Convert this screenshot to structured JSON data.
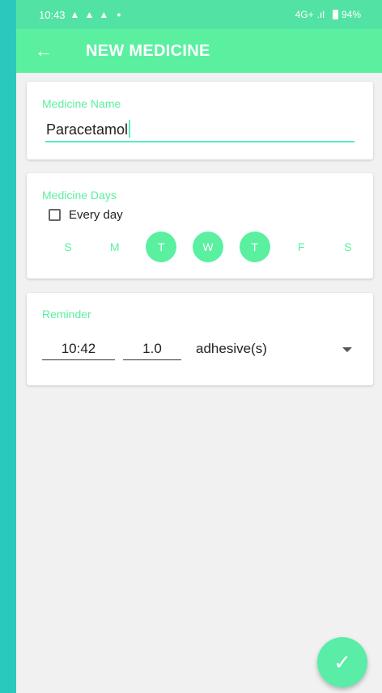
{
  "status_bar": {
    "time": "10:43",
    "notif_icons": [
      "snapchat-icon",
      "snapchat-icon",
      "snapchat-icon"
    ],
    "network": "4G+",
    "battery": "94%"
  },
  "app_bar": {
    "back_icon": "←",
    "title": "NEW MEDICINE"
  },
  "medicine_name": {
    "label": "Medicine Name",
    "value": "Paracetamol"
  },
  "medicine_days": {
    "label": "Medicine Days",
    "every_day_label": "Every day",
    "every_day_checked": false,
    "days": [
      {
        "label": "S",
        "selected": false
      },
      {
        "label": "M",
        "selected": false
      },
      {
        "label": "T",
        "selected": true
      },
      {
        "label": "W",
        "selected": true
      },
      {
        "label": "T",
        "selected": true
      },
      {
        "label": "F",
        "selected": false
      },
      {
        "label": "S",
        "selected": false
      }
    ]
  },
  "reminder": {
    "label": "Reminder",
    "time": "10:42",
    "dose": "1.0",
    "unit": "adhesive(s)"
  },
  "fab": {
    "icon": "✓"
  },
  "colors": {
    "accent": "#5af0a0",
    "status_bar": "#52e3a4",
    "background": "#2bc9bd",
    "underline": "#58ecc5"
  }
}
